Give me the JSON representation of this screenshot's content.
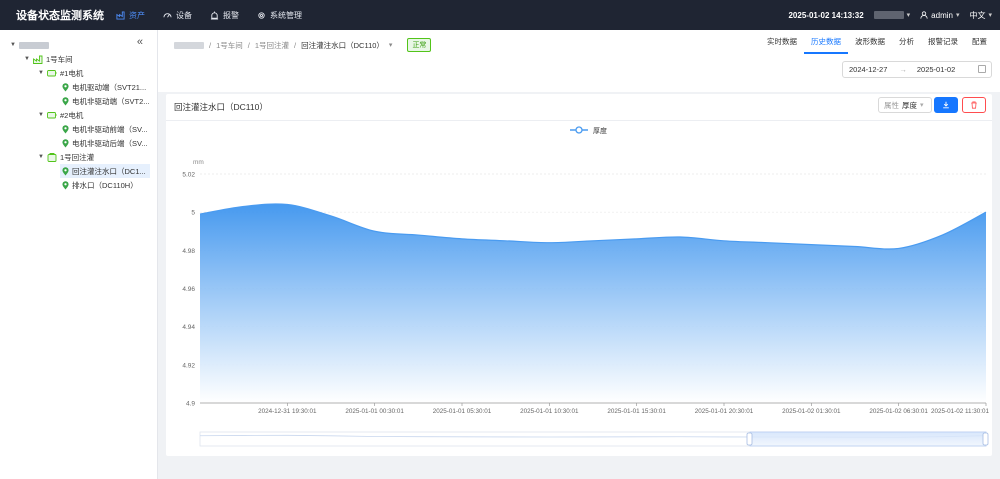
{
  "app": {
    "title": "设备状态监测系统"
  },
  "topnav": [
    {
      "label": "资产",
      "icon": "factory-icon",
      "active": true
    },
    {
      "label": "设备",
      "icon": "gauge-icon",
      "active": false
    },
    {
      "label": "报警",
      "icon": "alarm-icon",
      "active": false
    },
    {
      "label": "系统管理",
      "icon": "gear-icon",
      "active": false
    }
  ],
  "header": {
    "datetime": "2025-01-02 14:13:32",
    "user": "admin",
    "language": "中文"
  },
  "sidebar": {
    "collapse_icon": "double-chevron-left-icon",
    "tree": [
      {
        "label": "",
        "level": 0,
        "expanded": true,
        "icon": "none",
        "redacted": true
      },
      {
        "label": "1号车间",
        "level": 1,
        "expanded": true,
        "icon": "factory-icon"
      },
      {
        "label": "#1电机",
        "level": 2,
        "expanded": true,
        "icon": "motor-icon"
      },
      {
        "label": "电机驱动端（SVT21...",
        "level": 3,
        "icon": "location-pin-icon"
      },
      {
        "label": "电机非驱动端（SVT2...",
        "level": 3,
        "icon": "location-pin-icon"
      },
      {
        "label": "#2电机",
        "level": 2,
        "expanded": true,
        "icon": "motor-icon"
      },
      {
        "label": "电机非驱动前端（SV...",
        "level": 3,
        "icon": "location-pin-icon"
      },
      {
        "label": "电机非驱动后端（SV...",
        "level": 3,
        "icon": "location-pin-icon"
      },
      {
        "label": "1号回注灌",
        "level": 2,
        "expanded": true,
        "icon": "tank-icon"
      },
      {
        "label": "回注灌注水口（DC1...",
        "level": 3,
        "icon": "location-pin-icon",
        "selected": true
      },
      {
        "label": "排水口（DC110H）",
        "level": 3,
        "icon": "location-pin-icon"
      }
    ]
  },
  "breadcrumb": {
    "items": [
      "1号车间",
      "1号回注灌",
      "回注灌注水口（DC110）"
    ],
    "separator": "/",
    "status": "正常"
  },
  "tabs": [
    {
      "label": "实时数据",
      "active": false
    },
    {
      "label": "历史数据",
      "active": true
    },
    {
      "label": "波形数据",
      "active": false
    },
    {
      "label": "分析",
      "active": false
    },
    {
      "label": "报警记录",
      "active": false
    },
    {
      "label": "配置",
      "active": false
    }
  ],
  "date_range": {
    "start": "2024-12-27",
    "end": "2025-01-02",
    "arrow": "→"
  },
  "card": {
    "title": "回注灌注水口（DC110）",
    "property_label": "属性",
    "property_value": "厚度",
    "download_icon": "download-icon",
    "delete_icon": "trash-icon"
  },
  "colors": {
    "accent": "#1677ff",
    "header_bg": "#1f2533",
    "series": "#4a9bf0",
    "ok": "#52c41a",
    "danger": "#ff4d4f"
  },
  "chart_data": {
    "type": "area",
    "title": "",
    "xlabel": "",
    "ylabel": "mm",
    "legend": "top-center",
    "grid": true,
    "ylim": [
      4.9,
      5.02
    ],
    "yticks": [
      4.9,
      4.92,
      4.94,
      4.96,
      4.98,
      5,
      5.02
    ],
    "xtick_labels": [
      "2024-12-31 19:30:01",
      "2025-01-01 00:30:01",
      "2025-01-01 05:30:01",
      "2025-01-01 10:30:01",
      "2025-01-01 15:30:01",
      "2025-01-01 20:30:01",
      "2025-01-02 01:30:01",
      "2025-01-02 06:30:01",
      "2025-01-02 11:30:01"
    ],
    "series": [
      {
        "name": "厚度",
        "x": [
          "2024-12-31 14:30",
          "2024-12-31 17:00",
          "2024-12-31 19:30",
          "2024-12-31 22:00",
          "2025-01-01 00:30",
          "2025-01-01 03:00",
          "2025-01-01 05:30",
          "2025-01-01 08:00",
          "2025-01-01 10:30",
          "2025-01-01 13:00",
          "2025-01-01 15:30",
          "2025-01-01 18:00",
          "2025-01-01 20:30",
          "2025-01-01 23:00",
          "2025-01-02 01:30",
          "2025-01-02 04:00",
          "2025-01-02 06:30",
          "2025-01-02 09:00",
          "2025-01-02 11:30"
        ],
        "values": [
          4.999,
          5.003,
          5.004,
          4.998,
          4.99,
          4.988,
          4.986,
          4.985,
          4.984,
          4.985,
          4.986,
          4.987,
          4.985,
          4.984,
          4.983,
          4.982,
          4.981,
          4.988,
          5.0
        ]
      }
    ]
  }
}
